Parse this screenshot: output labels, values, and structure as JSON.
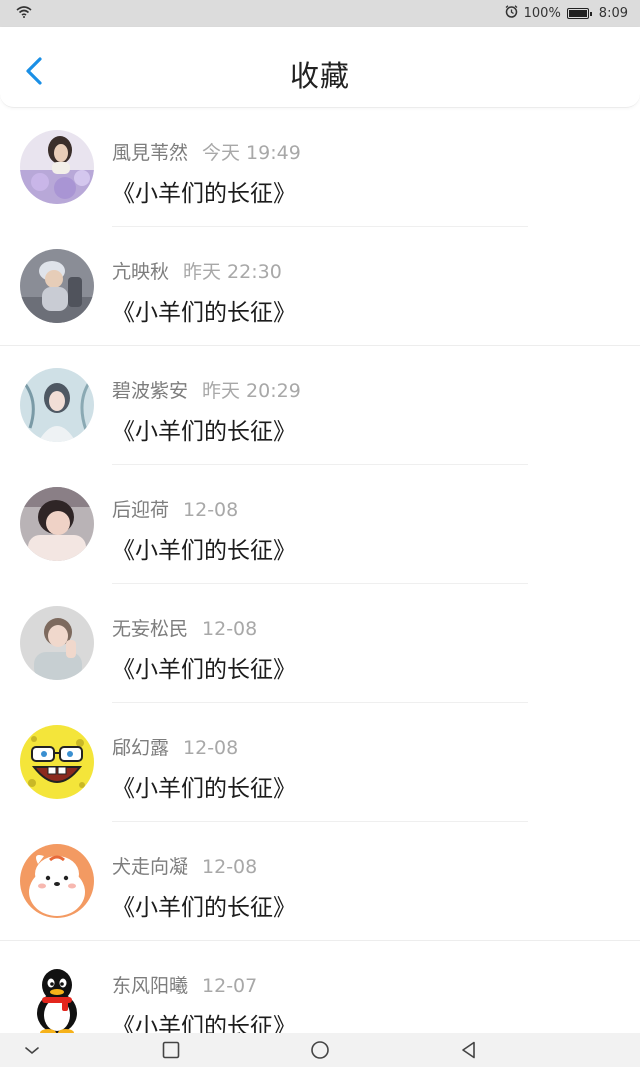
{
  "status_bar": {
    "battery_text": "100%",
    "time": "8:09",
    "icons": [
      "wifi-icon",
      "alarm-icon",
      "battery-icon"
    ]
  },
  "header": {
    "title": "收藏",
    "back_icon": "chevron-left-icon"
  },
  "accent_color": "#1a8fe6",
  "favorites": [
    {
      "user": "風見苇然",
      "time": "今天 19:49",
      "book": "《小羊们的长征》",
      "avatar": "photo-avatar"
    },
    {
      "user": "亢映秋",
      "time": "昨天 22:30",
      "book": "《小羊们的长征》",
      "avatar": "photo-avatar"
    },
    {
      "user": "碧波紫安",
      "time": "昨天 20:29",
      "book": "《小羊们的长征》",
      "avatar": "photo-avatar"
    },
    {
      "user": "后迎荷",
      "time": "12-08",
      "book": "《小羊们的长征》",
      "avatar": "photo-avatar"
    },
    {
      "user": "无妄松民",
      "time": "12-08",
      "book": "《小羊们的长征》",
      "avatar": "photo-avatar"
    },
    {
      "user": "郈幻露",
      "time": "12-08",
      "book": "《小羊们的长征》",
      "avatar": "spongebob-avatar"
    },
    {
      "user": "犬走向凝",
      "time": "12-08",
      "book": "《小羊们的长征》",
      "avatar": "cartoon-dog-avatar"
    },
    {
      "user": "东风阳曦",
      "time": "12-07",
      "book": "《小羊们的长征》",
      "avatar": "penguin-avatar"
    }
  ],
  "nav_bar": {
    "icons": [
      "chevron-down-icon",
      "square-icon",
      "circle-icon",
      "triangle-back-icon"
    ]
  }
}
